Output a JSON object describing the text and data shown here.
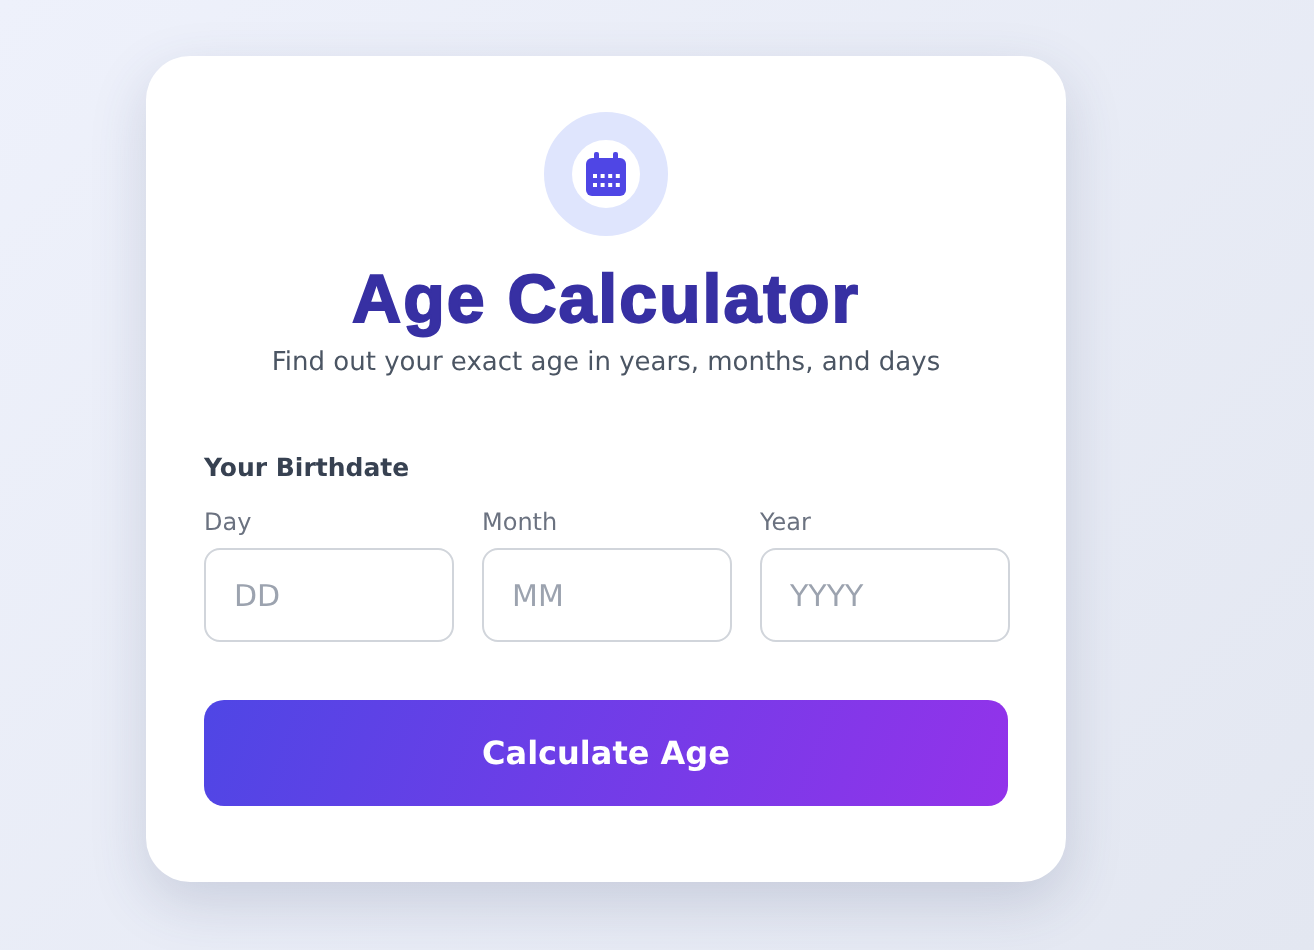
{
  "card": {
    "title": "Age Calculator",
    "subtitle": "Find out your exact age in years, months, and days"
  },
  "birthdate": {
    "label": "Your Birthdate",
    "fields": [
      {
        "label": "Day",
        "placeholder": "DD"
      },
      {
        "label": "Month",
        "placeholder": "MM"
      },
      {
        "label": "Year",
        "placeholder": "YYYY"
      }
    ]
  },
  "button": "Calculate Age"
}
